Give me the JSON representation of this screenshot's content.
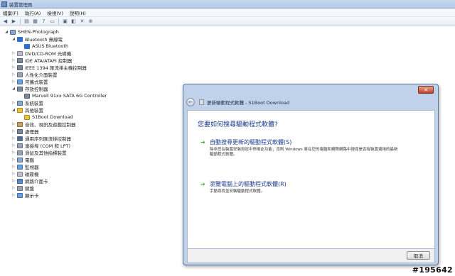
{
  "window": {
    "title": "裝置管理員"
  },
  "menu": [
    "檔案(F)",
    "執行(A)",
    "檢視(V)",
    "說明(H)"
  ],
  "toolbar": {
    "icons": [
      "back-icon",
      "forward-icon",
      "properties-icon",
      "refresh-icon",
      "help-icon",
      "monitor-icon",
      "update-driver-icon",
      "disable-icon",
      "uninstall-icon",
      "scan-icon"
    ]
  },
  "tree": {
    "root": "SHEN-Photograph",
    "items": [
      {
        "label": "Bluetooth 無線電",
        "icon": "bluetooth-icon",
        "expanded": true,
        "children": [
          "ASUS Bluetooth"
        ]
      },
      {
        "label": "DVD/CD-ROM 光碟機",
        "icon": "drive-icon"
      },
      {
        "label": "IDE ATA/ATAPI 控制器",
        "icon": "chip-icon"
      },
      {
        "label": "IEEE 1394 匯流排主機控制器",
        "icon": "chip-icon"
      },
      {
        "label": "人性化介面裝置",
        "icon": "hid-icon"
      },
      {
        "label": "可攜式裝置",
        "icon": "portable-icon"
      },
      {
        "label": "存放控制器",
        "icon": "chip-icon",
        "expanded": true,
        "children": [
          "Marvell 91xx SATA 6G Controller"
        ]
      },
      {
        "label": "系統裝置",
        "icon": "system-icon"
      },
      {
        "label": "其他裝置",
        "icon": "warning-icon",
        "expanded": true,
        "children": [
          "S1Boot Download"
        ]
      },
      {
        "label": "音效、視訊及遊戲控制器",
        "icon": "audio-icon"
      },
      {
        "label": "處理器",
        "icon": "cpu-icon"
      },
      {
        "label": "通用序列匯流排控制器",
        "icon": "usb-icon"
      },
      {
        "label": "連接埠 (COM 和 LPT)",
        "icon": "port-icon"
      },
      {
        "label": "滑鼠及其他指標裝置",
        "icon": "mouse-icon"
      },
      {
        "label": "電腦",
        "icon": "computer-icon"
      },
      {
        "label": "監視器",
        "icon": "monitor-icon"
      },
      {
        "label": "磁碟機",
        "icon": "disk-icon"
      },
      {
        "label": "網路介面卡",
        "icon": "network-icon"
      },
      {
        "label": "鍵盤",
        "icon": "keyboard-icon"
      },
      {
        "label": "顯示卡",
        "icon": "display-icon"
      }
    ]
  },
  "dialog": {
    "title": "更新驅動程式軟體 - S1Boot Download",
    "question": "您要如何搜尋驅動程式軟體?",
    "options": [
      {
        "title": "自動搜尋更新的驅動程式軟體(S)",
        "desc": "除非您在裝置安裝設定中停用此功能，否則 Windows 將在您的電腦和網際網路中搜尋是否有裝置適用的最新驅動程式軟體。"
      },
      {
        "title": "瀏覽電腦上的驅動程式軟體(R)",
        "desc": "手動尋找並安裝驅動程式軟體。"
      }
    ],
    "cancel_label": "取消",
    "close_glyph": "✕"
  },
  "watermark": "#195642"
}
